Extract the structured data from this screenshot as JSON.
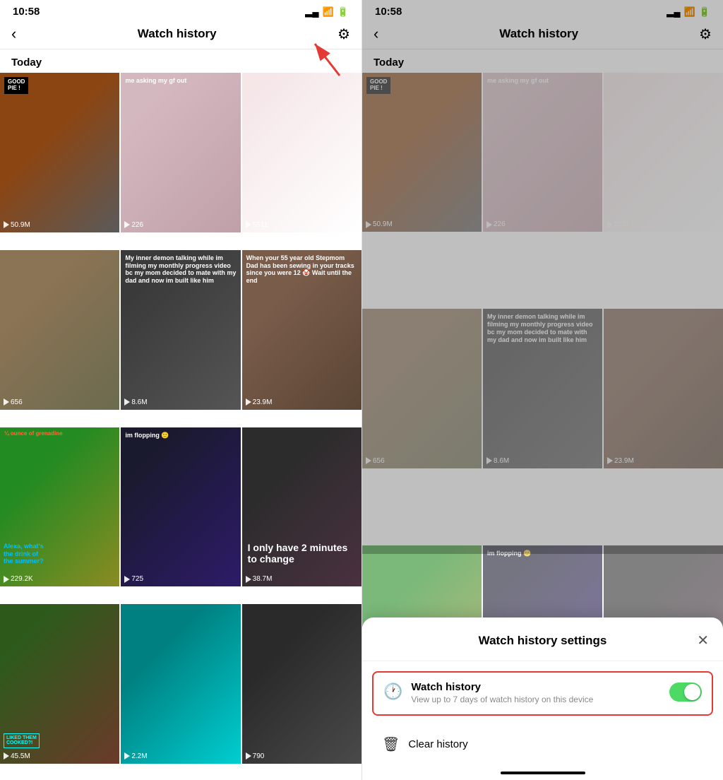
{
  "left_panel": {
    "status": {
      "time": "10:58"
    },
    "nav": {
      "back_label": "‹",
      "title": "Watch history",
      "gear_icon": "⚙"
    },
    "section": "Today",
    "videos": [
      {
        "id": 1,
        "class": "vc-1",
        "badge": "GOOD PIE !",
        "count": "50.9M"
      },
      {
        "id": 2,
        "class": "vc-2",
        "overlay": "me asking my gf out",
        "count": "226"
      },
      {
        "id": 3,
        "class": "vc-3",
        "overlay": "",
        "count": "5511"
      },
      {
        "id": 4,
        "class": "vc-4",
        "overlay": "",
        "count": "656"
      },
      {
        "id": 5,
        "class": "vc-5",
        "overlay": "My inner demon talking while im filming my monthly progress video bc my mom decided to mate with my dad and now im built like him",
        "count": "8.6M"
      },
      {
        "id": 6,
        "class": "vc-6",
        "overlay": "When your 55 year old Stepmom Dad has been sewing in your tracks since you were 12 🤡 Wait until the end",
        "count": "23.9M"
      },
      {
        "id": 7,
        "class": "vc-7",
        "overlay": "¼ ounce of grenadine",
        "sub_overlay": "Alexa, what's the drink of the summer?",
        "count": "229.2K"
      },
      {
        "id": 8,
        "class": "vc-8",
        "overlay": "im flopping 🙂",
        "count": "725"
      },
      {
        "id": 9,
        "class": "vc-9",
        "overlay": "I only have 2 minutes to change",
        "count": "38.7M"
      },
      {
        "id": 10,
        "class": "vc-10",
        "overlay": "",
        "count": "45.5M",
        "liked_badge": "LIKED THEM COOKED?!"
      },
      {
        "id": 11,
        "class": "vc-11",
        "overlay": "",
        "count": "2.2M"
      },
      {
        "id": 12,
        "class": "vc-15",
        "overlay": "",
        "count": "790"
      }
    ]
  },
  "right_panel": {
    "status": {
      "time": "10:58"
    },
    "nav": {
      "back_label": "‹",
      "title": "Watch history",
      "gear_icon": "⚙"
    },
    "section": "Today",
    "sheet": {
      "title": "Watch history settings",
      "close_label": "✕",
      "watch_history": {
        "label": "Watch history",
        "description": "View up to 7 days of watch history on this device",
        "enabled": true
      },
      "clear_history_label": "Clear history",
      "home_indicator": true
    }
  }
}
